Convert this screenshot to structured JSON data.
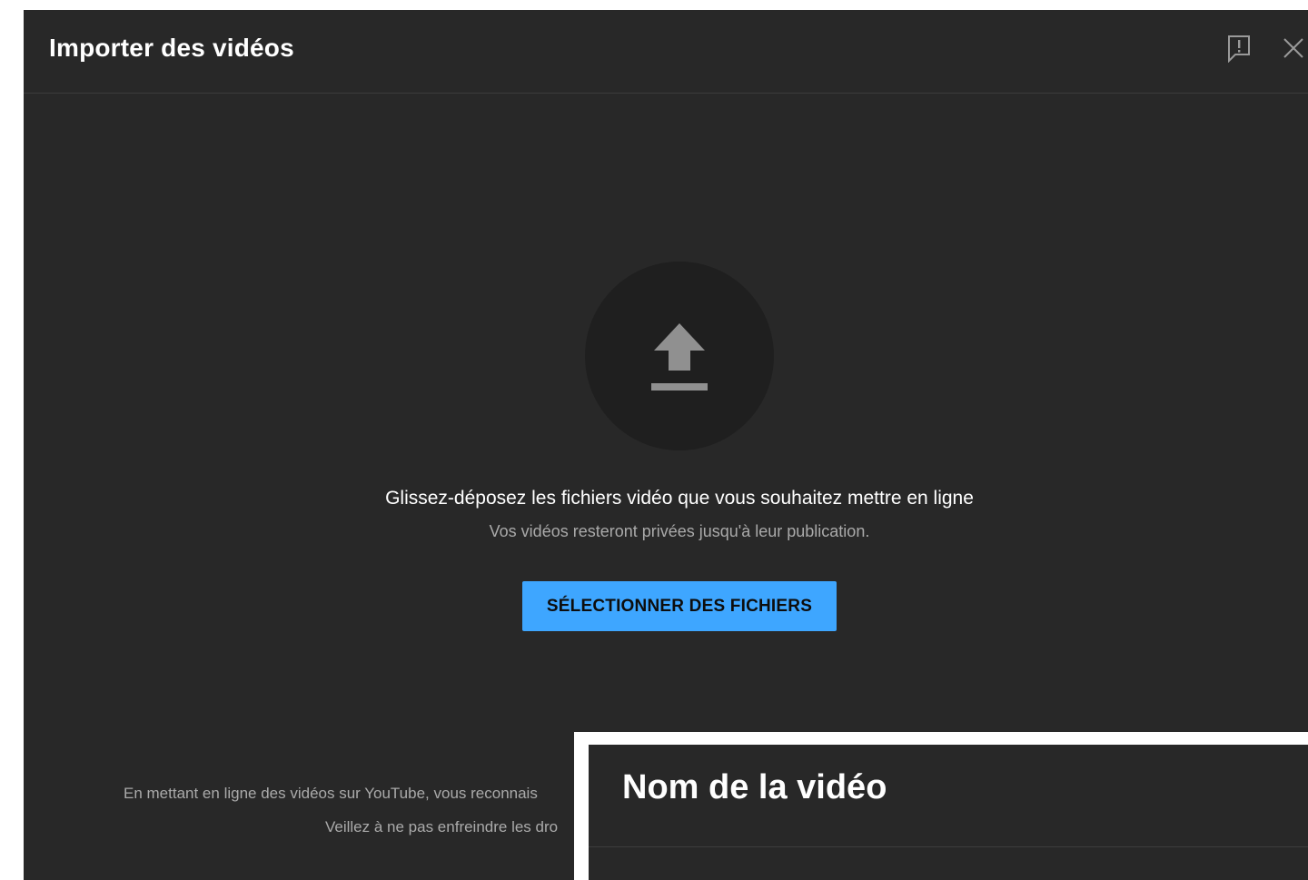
{
  "dialog": {
    "title": "Importer des vidéos",
    "feedback_icon": "feedback-icon",
    "close_icon": "close-icon"
  },
  "upload": {
    "icon": "upload-arrow-icon",
    "title": "Glissez-déposez les fichiers vidéo que vous souhaitez mettre en ligne",
    "subtitle": "Vos vidéos resteront privées jusqu'à leur publication.",
    "select_button": "SÉLECTIONNER DES FICHIERS"
  },
  "footer": {
    "line1": "En mettant en ligne des vidéos sur YouTube, vous reconnais",
    "line2": "Veillez à ne pas enfreindre les dro"
  },
  "overlay": {
    "title": "Nom de la vidéo"
  },
  "colors": {
    "background": "#282828",
    "accent": "#3ea6ff",
    "upload_circle": "#1f1f1f",
    "secondary_text": "#aaaaaa"
  }
}
